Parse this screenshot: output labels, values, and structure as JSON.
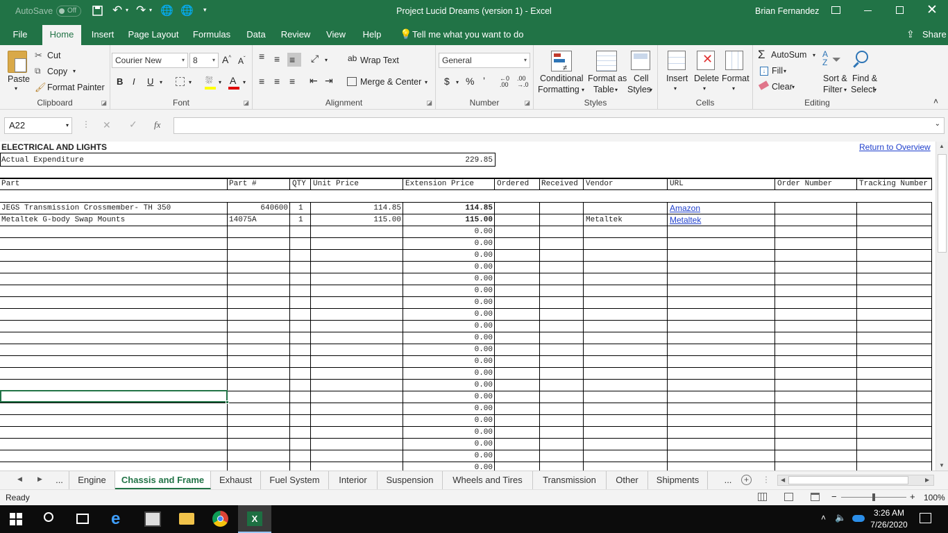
{
  "titlebar": {
    "autosave_label": "AutoSave",
    "autosave_state": "Off",
    "title": "Project Lucid Dreams (version 1)  -  Excel",
    "user": "Brian Fernandez"
  },
  "ribbon_tabs": [
    "File",
    "Home",
    "Insert",
    "Page Layout",
    "Formulas",
    "Data",
    "Review",
    "View",
    "Help"
  ],
  "tell_me": "Tell me what you want to do",
  "share_label": "Share",
  "clipboard": {
    "paste": "Paste",
    "cut": "Cut",
    "copy": "Copy",
    "format_painter": "Format Painter",
    "group": "Clipboard"
  },
  "font": {
    "name": "Courier New",
    "size": "8",
    "group": "Font"
  },
  "alignment": {
    "wrap": "Wrap Text",
    "merge": "Merge & Center",
    "group": "Alignment"
  },
  "number": {
    "format": "General",
    "group": "Number",
    "currency": "$",
    "percent": "%",
    "comma": "ʼ"
  },
  "styles": {
    "conditional_1": "Conditional",
    "conditional_2": "Formatting",
    "format_table_1": "Format as",
    "format_table_2": "Table",
    "cell_styles_1": "Cell",
    "cell_styles_2": "Styles",
    "group": "Styles"
  },
  "cells": {
    "insert": "Insert",
    "delete": "Delete",
    "format": "Format",
    "group": "Cells"
  },
  "editing": {
    "autosum": "AutoSum",
    "fill": "Fill",
    "clear": "Clear",
    "sort_1": "Sort &",
    "sort_2": "Filter",
    "find_1": "Find &",
    "find_2": "Select",
    "group": "Editing"
  },
  "name_box": "A22",
  "fx": "fx",
  "sheet": {
    "title": "ELECTRICAL AND LIGHTS",
    "return_link": "Return to Overview",
    "expenditure_label": "Actual Expenditure",
    "expenditure_value": "229.85",
    "headers": [
      "Part",
      "Part #",
      "QTY",
      "Unit Price",
      "Extension Price",
      "Ordered",
      "Received",
      "Vendor",
      "URL",
      "Order Number",
      "Tracking Number"
    ],
    "rows": [
      {
        "part": "JEGS Transmission Crossmember- TH 350",
        "partno": "640600",
        "qty": "1",
        "unit": "114.85",
        "ext": "114.85",
        "vendor": "",
        "url": "Amazon"
      },
      {
        "part": "Metaltek G-body Swap Mounts",
        "partno": "14075A",
        "qty": "1",
        "unit": "115.00",
        "ext": "115.00",
        "vendor": "Metaltek",
        "url": "Metaltek"
      }
    ],
    "zero_value": "0.00"
  },
  "sheet_tabs": [
    "...",
    "Engine",
    "Chassis and Frame",
    "Exhaust",
    "Fuel System",
    "Interior",
    "Suspension",
    "Wheels and Tires",
    "Transmission",
    "Other",
    "Shipments",
    "..."
  ],
  "active_sheet": "Chassis and Frame",
  "status": {
    "ready": "Ready",
    "zoom": "100%"
  },
  "taskbar": {
    "time": "3:26 AM",
    "date": "7/26/2020"
  },
  "colors": {
    "excel_green": "#217346",
    "link": "#1f3fcc"
  }
}
